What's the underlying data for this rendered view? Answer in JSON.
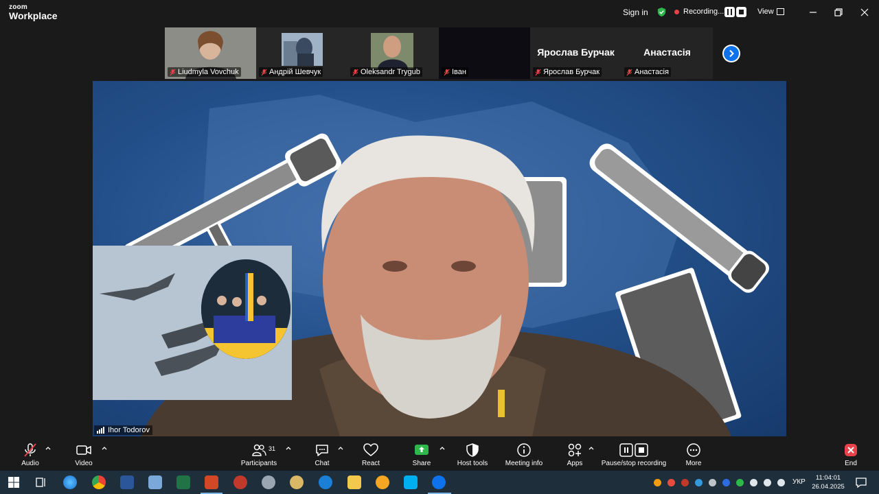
{
  "app": {
    "brand_small": "zoom",
    "brand_name": "Workplace"
  },
  "titlebar": {
    "sign_in": "Sign in",
    "recording_label": "Recording...",
    "view_label": "View",
    "colors": {
      "shield": "#2eb84b",
      "rec_dot": "#e8424a"
    }
  },
  "participants_strip": [
    {
      "name": "Liudmyla Vovchuk",
      "has_video": true,
      "muted": true
    },
    {
      "name": "Андрій Шевчук",
      "has_video": true,
      "muted": true
    },
    {
      "name": "Oleksandr Trygub",
      "has_video": true,
      "muted": true
    },
    {
      "name": "Іван",
      "has_video": false,
      "muted": true
    },
    {
      "name": "Ярослав Бурчак",
      "display_name": "Ярослав Бурчак",
      "has_video": false,
      "muted": true
    },
    {
      "name": "Анастасія",
      "display_name": "Анастасія",
      "has_video": false,
      "muted": true
    }
  ],
  "main_video": {
    "speaker_name": "Ihor Todorov"
  },
  "toolbar": {
    "audio": "Audio",
    "video": "Video",
    "participants": "Participants",
    "participants_count": "31",
    "chat": "Chat",
    "react": "React",
    "share": "Share",
    "host_tools": "Host tools",
    "meeting_info": "Meeting info",
    "apps": "Apps",
    "pause_stop_recording": "Pause/stop recording",
    "more": "More",
    "end": "End",
    "colors": {
      "share": "#2eb84b",
      "end": "#e8424a",
      "mute_slash": "#e8424a"
    }
  },
  "taskbar": {
    "apps": [
      "windows-start",
      "task-view",
      "browser",
      "chrome",
      "word",
      "notepad",
      "excel",
      "powerpoint",
      "app-red",
      "app-satellite",
      "app-paint",
      "app-mail",
      "file-explorer",
      "app-yandex",
      "skype",
      "zoom"
    ],
    "language": "УКР",
    "time": "11:04:01",
    "date": "26.04.2025"
  }
}
